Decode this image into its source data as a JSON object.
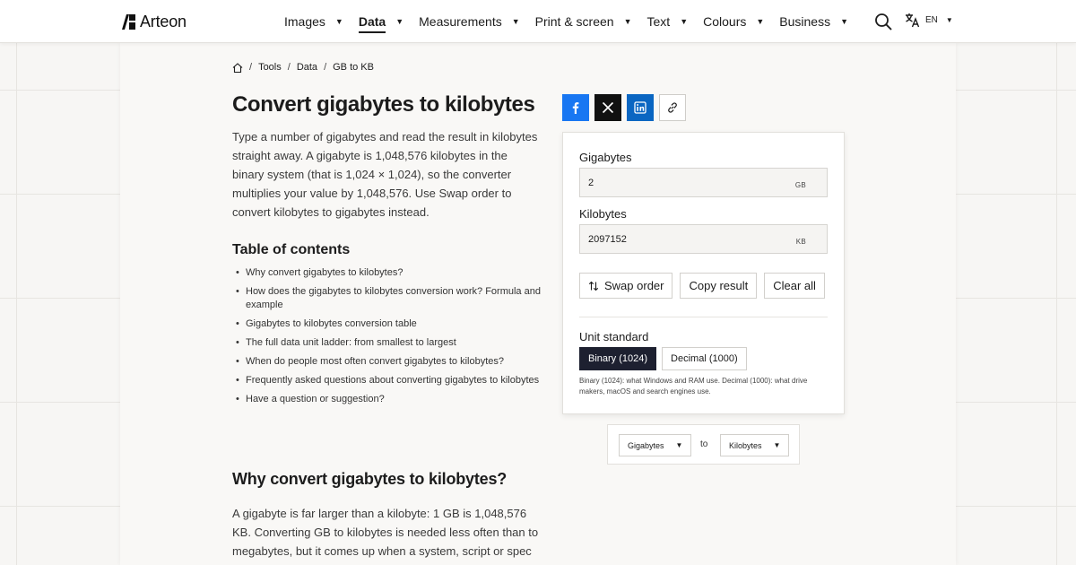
{
  "brand": {
    "name": "Arteon"
  },
  "nav": {
    "items": [
      {
        "label": "Images"
      },
      {
        "label": "Data"
      },
      {
        "label": "Measurements"
      },
      {
        "label": "Print & screen"
      },
      {
        "label": "Text"
      },
      {
        "label": "Colours"
      },
      {
        "label": "Business"
      }
    ],
    "active": "Data",
    "language": "EN"
  },
  "breadcrumb": {
    "items": [
      "Tools",
      "Data",
      "GB to KB"
    ]
  },
  "page": {
    "title": "Convert gigabytes to kilobytes",
    "intro": "Type a number of gigabytes and read the result in kilobytes straight away. A gigabyte is 1,048,576 kilobytes in the binary system (that is 1,024 × 1,024), so the converter multiplies your value by 1,048,576. Use Swap order to convert kilobytes to gigabytes instead.",
    "toc_title": "Table of contents",
    "toc": [
      "Why convert gigabytes to kilobytes?",
      "How does the gigabytes to kilobytes conversion work? Formula and example",
      "Gigabytes to kilobytes conversion table",
      "The full data unit ladder: from smallest to largest",
      "When do people most often convert gigabytes to kilobytes?",
      "Frequently asked questions about converting gigabytes to kilobytes",
      "Have a question or suggestion?"
    ],
    "section_title": "Why convert gigabytes to kilobytes?",
    "section_text": "A gigabyte is far larger than a kilobyte: 1 GB is 1,048,576 KB. Converting GB to kilobytes is needed less often than to megabytes, but it comes up when a system, script or spec"
  },
  "share": {
    "icons": [
      "facebook-icon",
      "x-icon",
      "linkedin-icon",
      "link-icon"
    ]
  },
  "converter": {
    "from": {
      "label": "Gigabytes",
      "value": "2",
      "unit": "GB"
    },
    "to": {
      "label": "Kilobytes",
      "value": "2097152",
      "unit": "KB"
    },
    "actions": {
      "swap": "Swap order",
      "copy": "Copy result",
      "clear": "Clear all"
    },
    "standard": {
      "label": "Unit standard",
      "binary": "Binary (1024)",
      "decimal": "Decimal (1000)",
      "selected": "Binary (1024)",
      "note": "Binary (1024): what Windows and RAM use. Decimal (1000): what drive makers, macOS and search engines use."
    }
  },
  "unit_picker": {
    "from": "Gigabytes",
    "to_word": "to",
    "to": "Kilobytes"
  },
  "colors": {
    "active_segment": "#1d2030",
    "facebook": "#1877f2",
    "x": "#111111",
    "linkedin": "#0a66c2"
  }
}
